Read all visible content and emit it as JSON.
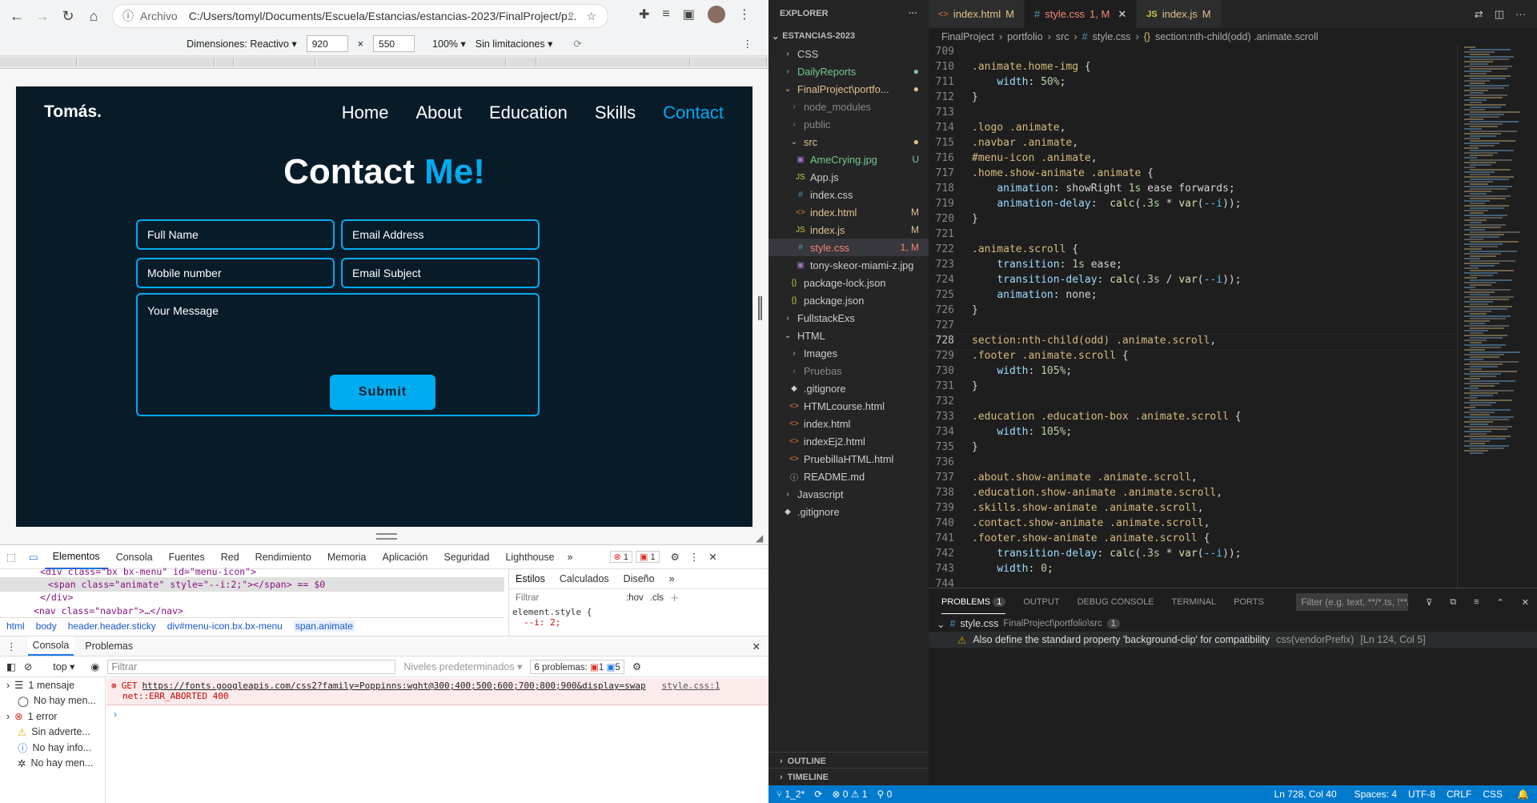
{
  "browser": {
    "url_label": "Archivo",
    "url": "C:/Users/tomyl/Documents/Escuela/Estancias/estancias-2023/FinalProject/p...",
    "device_bar": {
      "dimensions_label": "Dimensiones: Reactivo ▾",
      "width": "920",
      "height": "550",
      "zoom": "100% ▾",
      "throttle": "Sin limitaciones ▾",
      "times": "×"
    }
  },
  "site": {
    "logo": "Tomás.",
    "nav": [
      "Home",
      "About",
      "Education",
      "Skills",
      "Contact"
    ],
    "title_main": "Contact ",
    "title_accent": "Me!",
    "fields": {
      "full_name": "Full Name",
      "email": "Email Address",
      "mobile": "Mobile number",
      "subject": "Email Subject",
      "message": "Your Message"
    },
    "submit": "Submit"
  },
  "devtools": {
    "tabs": [
      "Elementos",
      "Consola",
      "Fuentes",
      "Red",
      "Rendimiento",
      "Memoria",
      "Aplicación",
      "Seguridad",
      "Lighthouse"
    ],
    "err_badge": "1",
    "issue_badge": "1",
    "elements_lines": [
      "<div class=\"bx bx-menu\" id=\"menu-icon\">",
      "<span class=\"animate\" style=\"--i:2;\"></span> == $0",
      "</div>",
      "<nav class=\"navbar\">…</nav>"
    ],
    "styles_tabs": [
      "Estilos",
      "Calculados",
      "Diseño"
    ],
    "styles_filter": "Filtrar",
    "styles_hov": ":hov",
    "styles_cls": ".cls",
    "styles_rule": "element.style {",
    "styles_prop": "--i: 2;",
    "breadcrumb": [
      "html",
      "body",
      "header.header.sticky",
      "div#menu-icon.bx.bx-menu",
      "span.animate"
    ],
    "console_tabs": [
      "Consola",
      "Problemas"
    ],
    "console_context": "top ▾",
    "console_filter": "Filtrar",
    "levels": "Niveles predeterminados ▾",
    "problems": "6 problemas:",
    "problems_err": "1",
    "problems_info": "5",
    "sidebar": [
      "1 mensaje",
      "No hay men...",
      "1 error",
      "Sin adverte...",
      "No hay info...",
      "No hay men..."
    ],
    "error_method": "GET",
    "error_url": "https://fonts.googleapis.com/css2?family=Poppinns:wght@300;400;500;600;700;800;900&display=swap",
    "error_source": "style.css:1",
    "error_status": "net::ERR_ABORTED 400"
  },
  "vscode": {
    "explorer_title": "EXPLORER",
    "root": "ESTANCIAS-2023",
    "tree": [
      {
        "label": "CSS",
        "depth": 1,
        "icon": "›",
        "cls": ""
      },
      {
        "label": "DailyReports",
        "depth": 1,
        "icon": "›",
        "cls": "untr",
        "badge": "●"
      },
      {
        "label": "FinalProject\\portfo...",
        "depth": 1,
        "icon": "⌄",
        "cls": "mod",
        "badge": "●"
      },
      {
        "label": "node_modules",
        "depth": 2,
        "icon": "›",
        "cls": "dim"
      },
      {
        "label": "public",
        "depth": 2,
        "icon": "›",
        "cls": "dim"
      },
      {
        "label": "src",
        "depth": 2,
        "icon": "⌄",
        "cls": "mod",
        "badge": "●"
      },
      {
        "label": "AmeCrying.jpg",
        "depth": 3,
        "icon": "▣",
        "cls": "untr",
        "badge": "U"
      },
      {
        "label": "App.js",
        "depth": 3,
        "icon": "JS",
        "cls": ""
      },
      {
        "label": "index.css",
        "depth": 3,
        "icon": "#",
        "cls": ""
      },
      {
        "label": "index.html",
        "depth": 3,
        "icon": "<>",
        "cls": "mod",
        "badge": "M"
      },
      {
        "label": "index.js",
        "depth": 3,
        "icon": "JS",
        "cls": "mod",
        "badge": "M"
      },
      {
        "label": "style.css",
        "depth": 3,
        "icon": "#",
        "cls": "err",
        "badge": "1, M",
        "active": true
      },
      {
        "label": "tony-skeor-miami-z.jpg",
        "depth": 3,
        "icon": "▣",
        "cls": ""
      },
      {
        "label": "package-lock.json",
        "depth": 2,
        "icon": "{}",
        "cls": ""
      },
      {
        "label": "package.json",
        "depth": 2,
        "icon": "{}",
        "cls": ""
      },
      {
        "label": "FullstackExs",
        "depth": 1,
        "icon": "›",
        "cls": ""
      },
      {
        "label": "HTML",
        "depth": 1,
        "icon": "⌄",
        "cls": ""
      },
      {
        "label": "Images",
        "depth": 2,
        "icon": "›",
        "cls": ""
      },
      {
        "label": "Pruebas",
        "depth": 2,
        "icon": "›",
        "cls": "dim"
      },
      {
        "label": ".gitignore",
        "depth": 2,
        "icon": "◆",
        "cls": ""
      },
      {
        "label": "HTMLcourse.html",
        "depth": 2,
        "icon": "<>",
        "cls": ""
      },
      {
        "label": "index.html",
        "depth": 2,
        "icon": "<>",
        "cls": ""
      },
      {
        "label": "indexEj2.html",
        "depth": 2,
        "icon": "<>",
        "cls": ""
      },
      {
        "label": "PruebillaHTML.html",
        "depth": 2,
        "icon": "<>",
        "cls": ""
      },
      {
        "label": "README.md",
        "depth": 2,
        "icon": "ⓘ",
        "cls": ""
      },
      {
        "label": "Javascript",
        "depth": 1,
        "icon": "›",
        "cls": ""
      },
      {
        "label": ".gitignore",
        "depth": 1,
        "icon": "◆",
        "cls": ""
      }
    ],
    "outline": "OUTLINE",
    "timeline": "TIMELINE",
    "tabs": [
      {
        "label": "index.html",
        "mark": "M",
        "icon": "<>",
        "color": "#e37933"
      },
      {
        "label": "style.css",
        "mark": "1, M",
        "icon": "#",
        "color": "#519aba",
        "active": true
      },
      {
        "label": "index.js",
        "mark": "M",
        "icon": "JS",
        "color": "#cbcb41"
      }
    ],
    "breadcrumb": [
      "FinalProject",
      "portfolio",
      "src",
      "style.css",
      "section:nth-child(odd) .animate.scroll"
    ],
    "code": [
      [
        "709",
        ""
      ],
      [
        "710",
        "<s>.animate.home-img</s> <p>{</p>"
      ],
      [
        "711",
        "    <k>width</k><p>:</p> <n>50%</n><p>;</p>"
      ],
      [
        "712",
        "<p>}</p>"
      ],
      [
        "713",
        ""
      ],
      [
        "714",
        "<s>.logo .animate</s><p>,</p>"
      ],
      [
        "715",
        "<s>.navbar .animate</s><p>,</p>"
      ],
      [
        "716",
        "<s>#menu-icon .animate</s><p>,</p>"
      ],
      [
        "717",
        "<s>.home.show-animate .animate</s> <p>{</p>"
      ],
      [
        "718",
        "    <k>animation</k><p>: showRight </p><n>1s</n><p> ease forwards;</p>"
      ],
      [
        "719",
        "    <k>animation-delay</k><p>:  </p><f>calc</f><p>(</p><n>.3s</n><p> * </p><f>var</f><p>(</p><v>--i</v><p>));</p>"
      ],
      [
        "720",
        "<p>}</p>"
      ],
      [
        "721",
        ""
      ],
      [
        "722",
        "<s>.animate.scroll</s> <p>{</p>"
      ],
      [
        "723",
        "    <k>transition</k><p>: </p><n>1s</n><p> ease;</p>"
      ],
      [
        "724",
        "    <k>transition-delay</k><p>: </p><f>calc</f><p>(</p><n>.3s</n><p> / </p><f>var</f><p>(</p><v>--i</v><p>));</p>"
      ],
      [
        "725",
        "    <k>animation</k><p>: none;</p>"
      ],
      [
        "726",
        "<p>}</p>"
      ],
      [
        "727",
        ""
      ],
      [
        "728",
        "<s>section:nth-child(odd) .animate.scroll</s><p>,</p>"
      ],
      [
        "729",
        "<s>.footer .animate.scroll</s> <p>{</p>"
      ],
      [
        "730",
        "    <k>width</k><p>:</p> <n>105%</n><p>;</p>"
      ],
      [
        "731",
        "<p>}</p>"
      ],
      [
        "732",
        ""
      ],
      [
        "733",
        "<s>.education .education-box .animate.scroll</s> <p>{</p>"
      ],
      [
        "734",
        "    <k>width</k><p>:</p> <n>105%</n><p>;</p>"
      ],
      [
        "735",
        "<p>}</p>"
      ],
      [
        "736",
        ""
      ],
      [
        "737",
        "<s>.about.show-animate .animate.scroll</s><p>,</p>"
      ],
      [
        "738",
        "<s>.education.show-animate .animate.scroll</s><p>,</p>"
      ],
      [
        "739",
        "<s>.skills.show-animate .animate.scroll</s><p>,</p>"
      ],
      [
        "740",
        "<s>.contact.show-animate .animate.scroll</s><p>,</p>"
      ],
      [
        "741",
        "<s>.footer.show-animate .animate.scroll</s> <p>{</p>"
      ],
      [
        "742",
        "    <k>transition-delay</k><p>: </p><f>calc</f><p>(</p><n>.3s</n><p> * </p><f>var</f><p>(</p><v>--i</v><p>));</p>"
      ],
      [
        "743",
        "    <k>width</k><p>:</p> <n>0</n><p>;</p>"
      ],
      [
        "744",
        ""
      ]
    ],
    "current_line": "728",
    "panel_tabs": [
      "PROBLEMS",
      "OUTPUT",
      "DEBUG CONSOLE",
      "TERMINAL",
      "PORTS"
    ],
    "problems_count": "1",
    "panel_filter": "Filter (e.g. text, **/*.ts, !**/...",
    "problem_file": "style.css",
    "problem_path": "FinalProject\\portfolio\\src",
    "problem_file_count": "1",
    "problem_msg": "Also define the standard property 'background-clip' for compatibility",
    "problem_src": "css(vendorPrefix)",
    "problem_loc": "[Ln 124, Col 5]",
    "status": {
      "branch": "1_2*",
      "errors": "0",
      "warnings": "1",
      "ports": "0",
      "position": "Ln 728, Col 40",
      "spaces": "Spaces: 4",
      "encoding": "UTF-8",
      "eol": "CRLF",
      "language": "CSS"
    },
    "colors": {
      "accent": "#00abf0",
      "status": "#007acc"
    }
  }
}
